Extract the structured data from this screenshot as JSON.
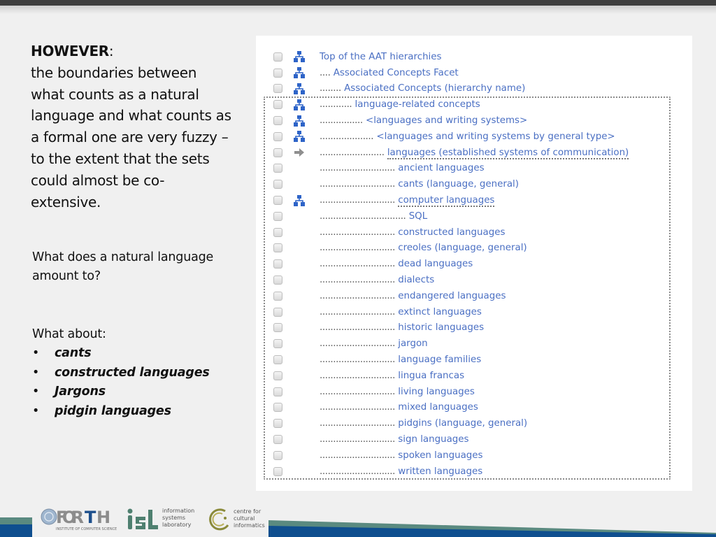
{
  "slide": {
    "heading": {
      "bold": "HOWEVER",
      "colon": ":",
      "lines": [
        "the boundaries between",
        "what counts as a natural",
        "language and what counts as",
        "a formal one are very fuzzy –",
        "to the extent that the sets",
        "could almost be co-",
        "extensive."
      ]
    },
    "question": [
      "What does a natural language",
      "amount to?"
    ],
    "about": {
      "title": "What about:",
      "bullet": "•",
      "items": [
        "cants",
        "constructed languages",
        "Jargons",
        "pidgin languages"
      ]
    }
  },
  "hierarchy": {
    "icons": {
      "hierarchy": "hierarchy-icon",
      "arrow": "arrow-right-icon"
    },
    "rows": [
      {
        "dots": "",
        "term": "Top of the AAT hierarchies",
        "icon": "hierarchy",
        "underlined": false
      },
      {
        "dots": "....",
        "term": "Associated Concepts Facet",
        "icon": "hierarchy",
        "underlined": false
      },
      {
        "dots": "........",
        "term": "Associated Concepts (hierarchy name)",
        "icon": "hierarchy",
        "underlined": false
      },
      {
        "dots": "............",
        "term": "language-related concepts",
        "icon": "hierarchy",
        "underlined": false
      },
      {
        "dots": "................",
        "term": "<languages and writing systems>",
        "icon": "hierarchy",
        "underlined": false
      },
      {
        "dots": "....................",
        "term": "<languages and writing systems by general type>",
        "icon": "hierarchy",
        "underlined": false
      },
      {
        "dots": "........................",
        "term": "languages (established systems of communication)",
        "icon": "arrow",
        "underlined": true
      },
      {
        "dots": "............................",
        "term": "ancient languages",
        "icon": "",
        "underlined": false
      },
      {
        "dots": "............................",
        "term": "cants (language, general)",
        "icon": "",
        "underlined": false
      },
      {
        "dots": "............................",
        "term": "computer languages",
        "icon": "hierarchy",
        "underlined": true
      },
      {
        "dots": "................................",
        "term": "SQL",
        "icon": "",
        "underlined": false
      },
      {
        "dots": "............................",
        "term": "constructed languages",
        "icon": "",
        "underlined": false
      },
      {
        "dots": "............................",
        "term": "creoles (language, general)",
        "icon": "",
        "underlined": false
      },
      {
        "dots": "............................",
        "term": "dead languages",
        "icon": "",
        "underlined": false
      },
      {
        "dots": "............................",
        "term": "dialects",
        "icon": "",
        "underlined": false
      },
      {
        "dots": "............................",
        "term": "endangered languages",
        "icon": "",
        "underlined": false
      },
      {
        "dots": "............................",
        "term": "extinct languages",
        "icon": "",
        "underlined": false
      },
      {
        "dots": "............................",
        "term": "historic languages",
        "icon": "",
        "underlined": false
      },
      {
        "dots": "............................",
        "term": "jargon",
        "icon": "",
        "underlined": false
      },
      {
        "dots": "............................",
        "term": "language families",
        "icon": "",
        "underlined": false
      },
      {
        "dots": "............................",
        "term": "lingua francas",
        "icon": "",
        "underlined": false
      },
      {
        "dots": "............................",
        "term": "living languages",
        "icon": "",
        "underlined": false
      },
      {
        "dots": "............................",
        "term": "mixed languages",
        "icon": "",
        "underlined": false
      },
      {
        "dots": "............................",
        "term": "pidgins (language, general)",
        "icon": "",
        "underlined": false
      },
      {
        "dots": "............................",
        "term": "sign languages",
        "icon": "",
        "underlined": false
      },
      {
        "dots": "............................",
        "term": "spoken languages",
        "icon": "",
        "underlined": false
      },
      {
        "dots": "............................",
        "term": "written languages",
        "icon": "",
        "underlined": false
      }
    ]
  },
  "footer": {
    "forth": {
      "name": "FORTH",
      "subtitle": "INSTITUTE OF COMPUTER SCIENCE"
    },
    "isl": {
      "name": "isl",
      "lines": [
        "information",
        "systems",
        "laboratory"
      ]
    },
    "cci": {
      "lines": [
        "centre for",
        "cultural",
        "informatics"
      ]
    }
  },
  "colors": {
    "link": "#4a6fc3",
    "icon_blue": "#2e64c8",
    "band_teal": "#5a8a80",
    "band_blue": "#0f4f8f",
    "isl_green": "#4f8070",
    "cci_olive": "#8a8a3a"
  }
}
